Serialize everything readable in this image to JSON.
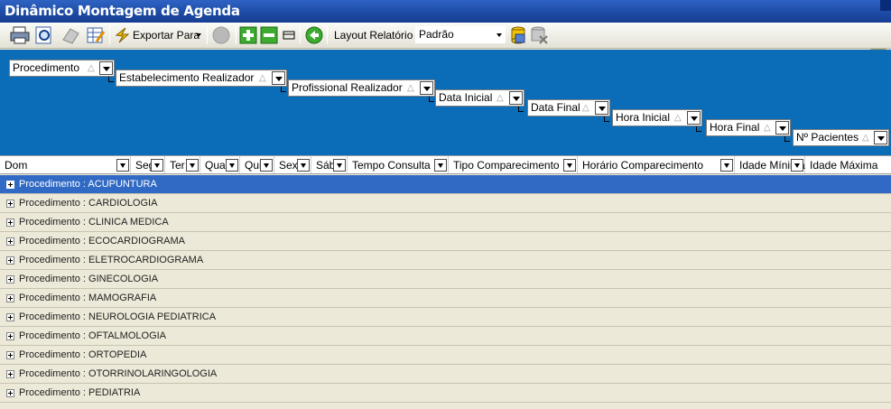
{
  "window": {
    "title": "Dinâmico Montagem de Agenda"
  },
  "toolbar": {
    "export_label": "Exportar Para",
    "layout_label": "Layout Relatório",
    "layout_value": "Padrão"
  },
  "group_area": {
    "fields": [
      {
        "label": "Procedimento"
      },
      {
        "label": "Estabelecimento Realizador"
      },
      {
        "label": "Profissional Realizador"
      },
      {
        "label": "Data Inicial"
      },
      {
        "label": "Data Final"
      },
      {
        "label": "Hora Inicial"
      },
      {
        "label": "Hora Final"
      },
      {
        "label": "Nº Pacientes"
      }
    ],
    "sort_glyph": "△"
  },
  "columns": [
    "Dom",
    "Seg",
    "Ter",
    "Qua",
    "Qui",
    "Sex",
    "Sáb",
    "Tempo Consulta",
    "Tipo Comparecimento",
    "Horário Comparecimento",
    "Idade Mínima",
    "Idade Máxima"
  ],
  "rows": [
    {
      "label": "Procedimento : ACUPUNTURA",
      "selected": true
    },
    {
      "label": "Procedimento : CARDIOLOGIA"
    },
    {
      "label": "Procedimento : CLINICA MEDICA"
    },
    {
      "label": "Procedimento : ECOCARDIOGRAMA"
    },
    {
      "label": "Procedimento : ELETROCARDIOGRAMA"
    },
    {
      "label": "Procedimento : GINECOLOGIA"
    },
    {
      "label": "Procedimento : MAMOGRAFIA"
    },
    {
      "label": "Procedimento : NEUROLOGIA PEDIATRICA"
    },
    {
      "label": "Procedimento : OFTALMOLOGIA"
    },
    {
      "label": "Procedimento : ORTOPEDIA"
    },
    {
      "label": "Procedimento : OTORRINOLARINGOLOGIA"
    },
    {
      "label": "Procedimento : PEDIATRIA"
    }
  ],
  "colors": {
    "title_bar": "#1d4aa3",
    "group_area": "#0b6db8",
    "selected_row": "#316ac5"
  },
  "icons": [
    "print-icon",
    "print-preview-icon",
    "eraser-icon",
    "edit-grid-icon",
    "export-icon",
    "disabled-icon",
    "add-icon",
    "remove-icon",
    "layout-icon",
    "back-icon",
    "save-layout-icon",
    "delete-layout-icon",
    "exit-icon"
  ]
}
